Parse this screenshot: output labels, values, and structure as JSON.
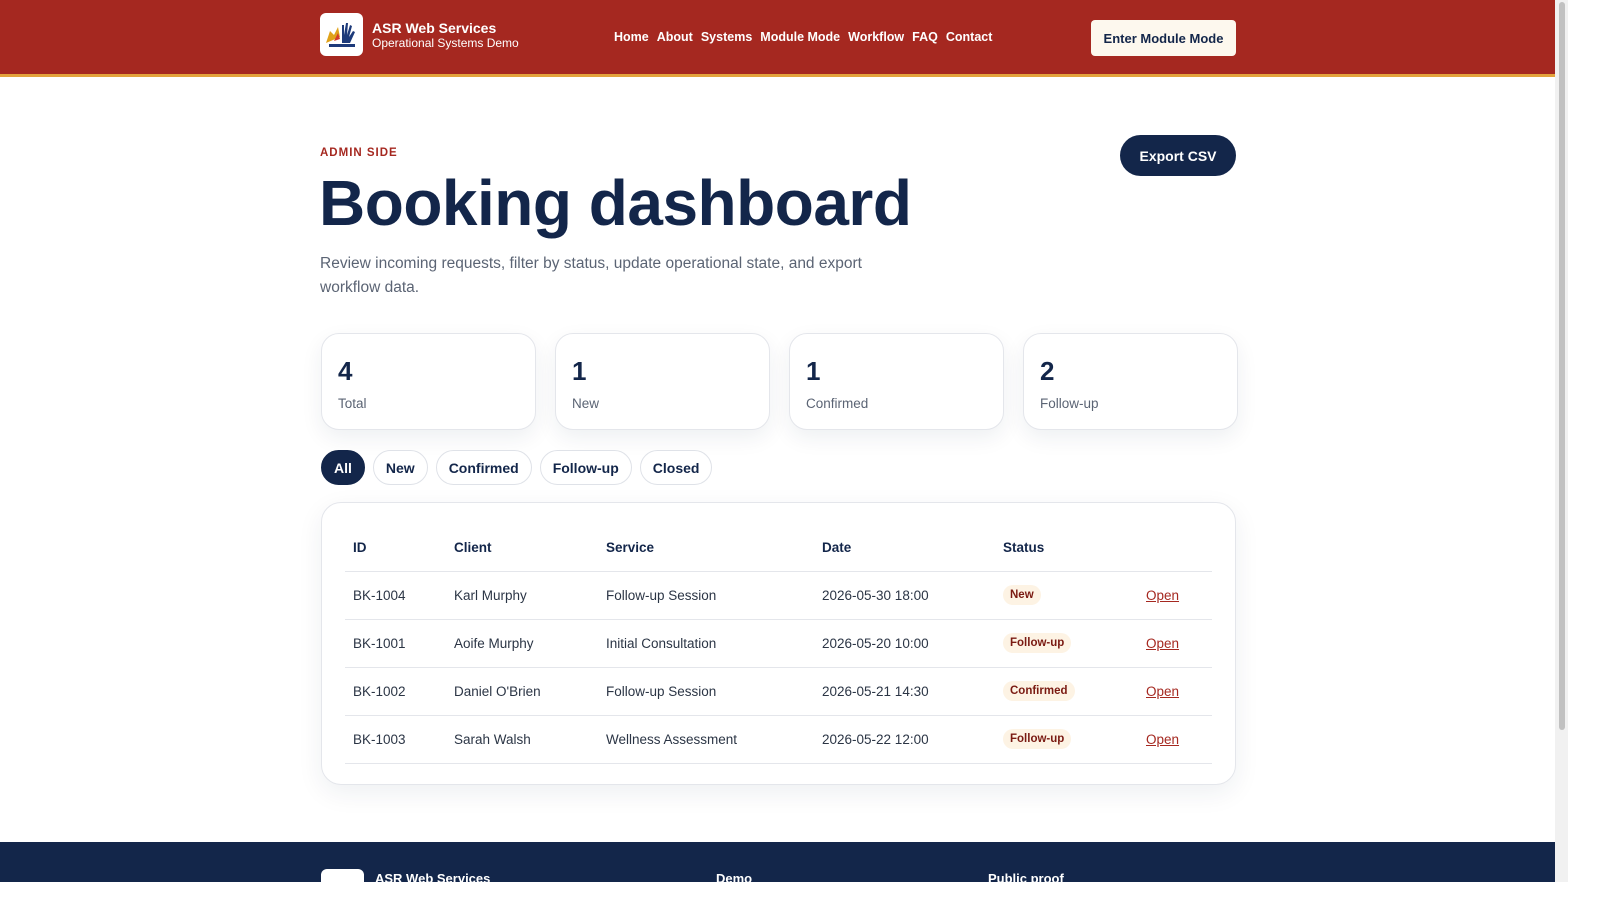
{
  "header": {
    "brand_name": "ASR Web Services",
    "brand_sub": "Operational Systems Demo",
    "nav": [
      "Home",
      "About",
      "Systems",
      "Module Mode",
      "Workflow",
      "FAQ",
      "Contact"
    ],
    "cta_label": "Enter Module Mode"
  },
  "hero": {
    "eyebrow": "ADMIN SIDE",
    "title": "Booking dashboard",
    "description": "Review incoming requests, filter by status, update operational state, and export workflow data.",
    "export_label": "Export CSV"
  },
  "stats": [
    {
      "value": "4",
      "label": "Total"
    },
    {
      "value": "1",
      "label": "New"
    },
    {
      "value": "1",
      "label": "Confirmed"
    },
    {
      "value": "2",
      "label": "Follow-up"
    }
  ],
  "filters": [
    "All",
    "New",
    "Confirmed",
    "Follow-up",
    "Closed"
  ],
  "table": {
    "columns": [
      "ID",
      "Client",
      "Service",
      "Date",
      "Status"
    ],
    "rows": [
      {
        "id": "BK-1004",
        "client": "Karl Murphy",
        "service": "Follow-up Session",
        "date": "2026-05-30 18:00",
        "status": "New",
        "action": "Open"
      },
      {
        "id": "BK-1001",
        "client": "Aoife Murphy",
        "service": "Initial Consultation",
        "date": "2026-05-20 10:00",
        "status": "Follow-up",
        "action": "Open"
      },
      {
        "id": "BK-1002",
        "client": "Daniel O'Brien",
        "service": "Follow-up Session",
        "date": "2026-05-21 14:30",
        "status": "Confirmed",
        "action": "Open"
      },
      {
        "id": "BK-1003",
        "client": "Sarah Walsh",
        "service": "Wellness Assessment",
        "date": "2026-05-22 12:00",
        "status": "Follow-up",
        "action": "Open"
      }
    ]
  },
  "footer": {
    "brand_name": "ASR Web Services",
    "col1_title": "Demo",
    "col2_title": "Public proof"
  },
  "colors": {
    "header_bg": "#a52820",
    "header_accent": "#e3a33c",
    "navy": "#13264a",
    "badge_bg": "#fdf3e4"
  }
}
